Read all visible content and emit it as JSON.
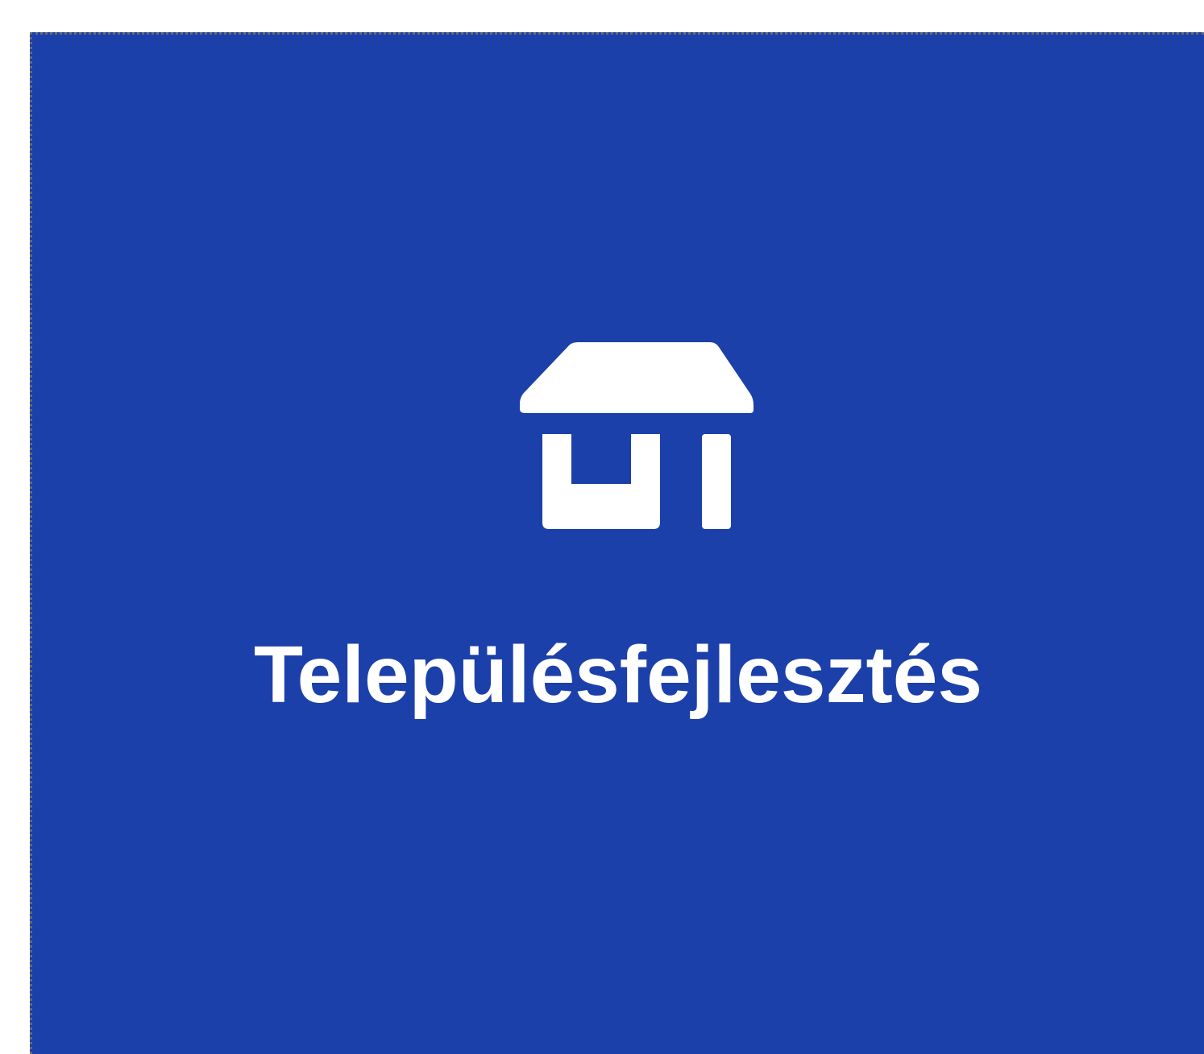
{
  "tile": {
    "label": "Településfejlesztés",
    "icon": "store-icon",
    "background_color": "#1c40aa",
    "foreground_color": "#ffffff"
  }
}
